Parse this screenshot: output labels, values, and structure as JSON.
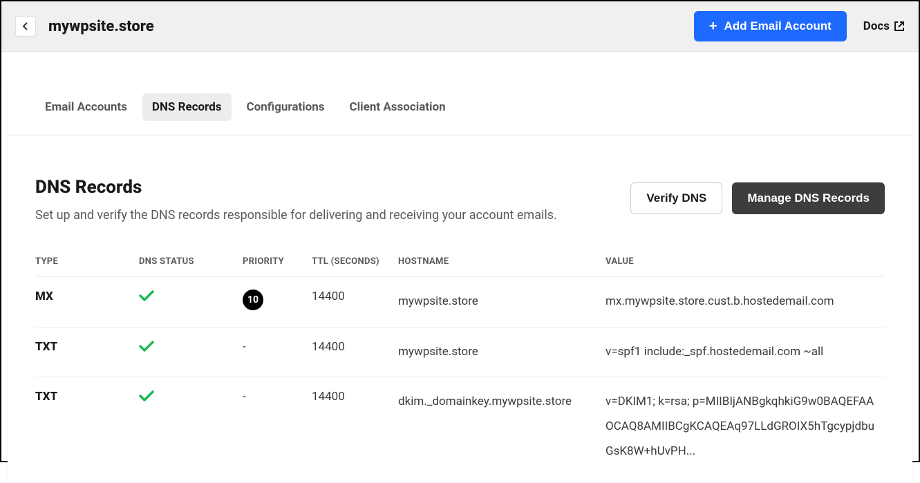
{
  "header": {
    "domain": "mywpsite.store",
    "add_email_label": "Add Email Account",
    "docs_label": "Docs"
  },
  "tabs": [
    {
      "label": "Email Accounts",
      "active": false
    },
    {
      "label": "DNS Records",
      "active": true
    },
    {
      "label": "Configurations",
      "active": false
    },
    {
      "label": "Client Association",
      "active": false
    }
  ],
  "section": {
    "title": "DNS Records",
    "description": "Set up and verify the DNS records responsible for delivering and receiving your account emails.",
    "verify_label": "Verify DNS",
    "manage_label": "Manage DNS Records"
  },
  "table": {
    "headers": {
      "type": "TYPE",
      "status": "DNS STATUS",
      "priority": "PRIORITY",
      "ttl": "TTL (SECONDS)",
      "hostname": "HOSTNAME",
      "value": "VALUE"
    },
    "rows": [
      {
        "type": "MX",
        "status": "ok",
        "priority": "10",
        "ttl": "14400",
        "hostname": "mywpsite.store",
        "value": "mx.mywpsite.store.cust.b.hostedemail.com"
      },
      {
        "type": "TXT",
        "status": "ok",
        "priority": "-",
        "ttl": "14400",
        "hostname": "mywpsite.store",
        "value": "v=spf1 include:_spf.hostedemail.com ~all"
      },
      {
        "type": "TXT",
        "status": "ok",
        "priority": "-",
        "ttl": "14400",
        "hostname": "dkim._domainkey.mywpsite.store",
        "value": "v=DKIM1; k=rsa; p=MIIBIjANBgkqhkiG9w0BAQEFAAOCAQ8AMIIBCgKCAQEAq97LLdGROIX5hTgcypjdbuGsK8W+hUvPH..."
      }
    ]
  }
}
